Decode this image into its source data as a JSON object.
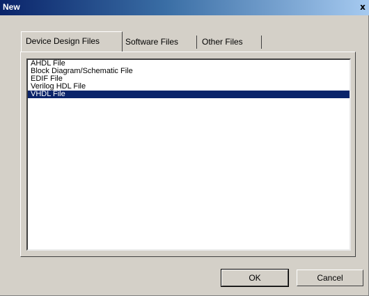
{
  "window": {
    "title": "New",
    "close_glyph": "x"
  },
  "tabs": [
    {
      "label": "Device Design Files",
      "active": true
    },
    {
      "label": "Software Files",
      "active": false
    },
    {
      "label": "Other Files",
      "active": false
    }
  ],
  "file_list": {
    "items": [
      {
        "label": "AHDL File",
        "selected": false
      },
      {
        "label": "Block Diagram/Schematic File",
        "selected": false
      },
      {
        "label": "EDIF File",
        "selected": false
      },
      {
        "label": "Verilog HDL File",
        "selected": false
      },
      {
        "label": "VHDL File",
        "selected": true
      }
    ]
  },
  "buttons": {
    "ok_label": "OK",
    "cancel_label": "Cancel"
  },
  "colors": {
    "selection": "#0a246a",
    "dialog_face": "#d4d0c8",
    "title_gradient_start": "#0a246a"
  }
}
